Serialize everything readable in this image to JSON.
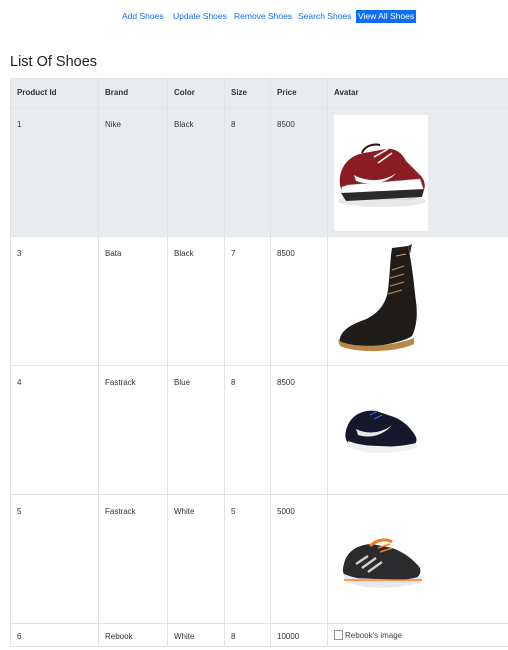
{
  "nav": {
    "items": [
      "Add Shoes",
      "Update Shoes",
      "Remove Shoes",
      "Search Shoes",
      "View All Shoes"
    ],
    "active": "View All Shoes"
  },
  "page": {
    "title": "List Of Shoes"
  },
  "table": {
    "headers": [
      "Product Id",
      "Brand",
      "Color",
      "Size",
      "Price",
      "Avatar"
    ],
    "rows": [
      {
        "id": "1",
        "brand": "Nike",
        "color": "Black",
        "size": "8",
        "price": "8500",
        "avatar": "red-sneaker"
      },
      {
        "id": "3",
        "brand": "Bata",
        "color": "Black",
        "size": "7",
        "price": "8500",
        "avatar": "black-boot"
      },
      {
        "id": "4",
        "brand": "Fastrack",
        "color": "Blue",
        "size": "8",
        "price": "8500",
        "avatar": "navy-sneaker"
      },
      {
        "id": "5",
        "brand": "Fastrack",
        "color": "White",
        "size": "5",
        "price": "5000",
        "avatar": "running-shoe"
      },
      {
        "id": "6",
        "brand": "Rebook",
        "color": "White",
        "size": "8",
        "price": "10000",
        "avatar_alt": "Rebook's image"
      }
    ]
  },
  "colors": {
    "link": "#0d6efd",
    "header_bg": "#e9ecef",
    "border": "#e2e3e5"
  }
}
